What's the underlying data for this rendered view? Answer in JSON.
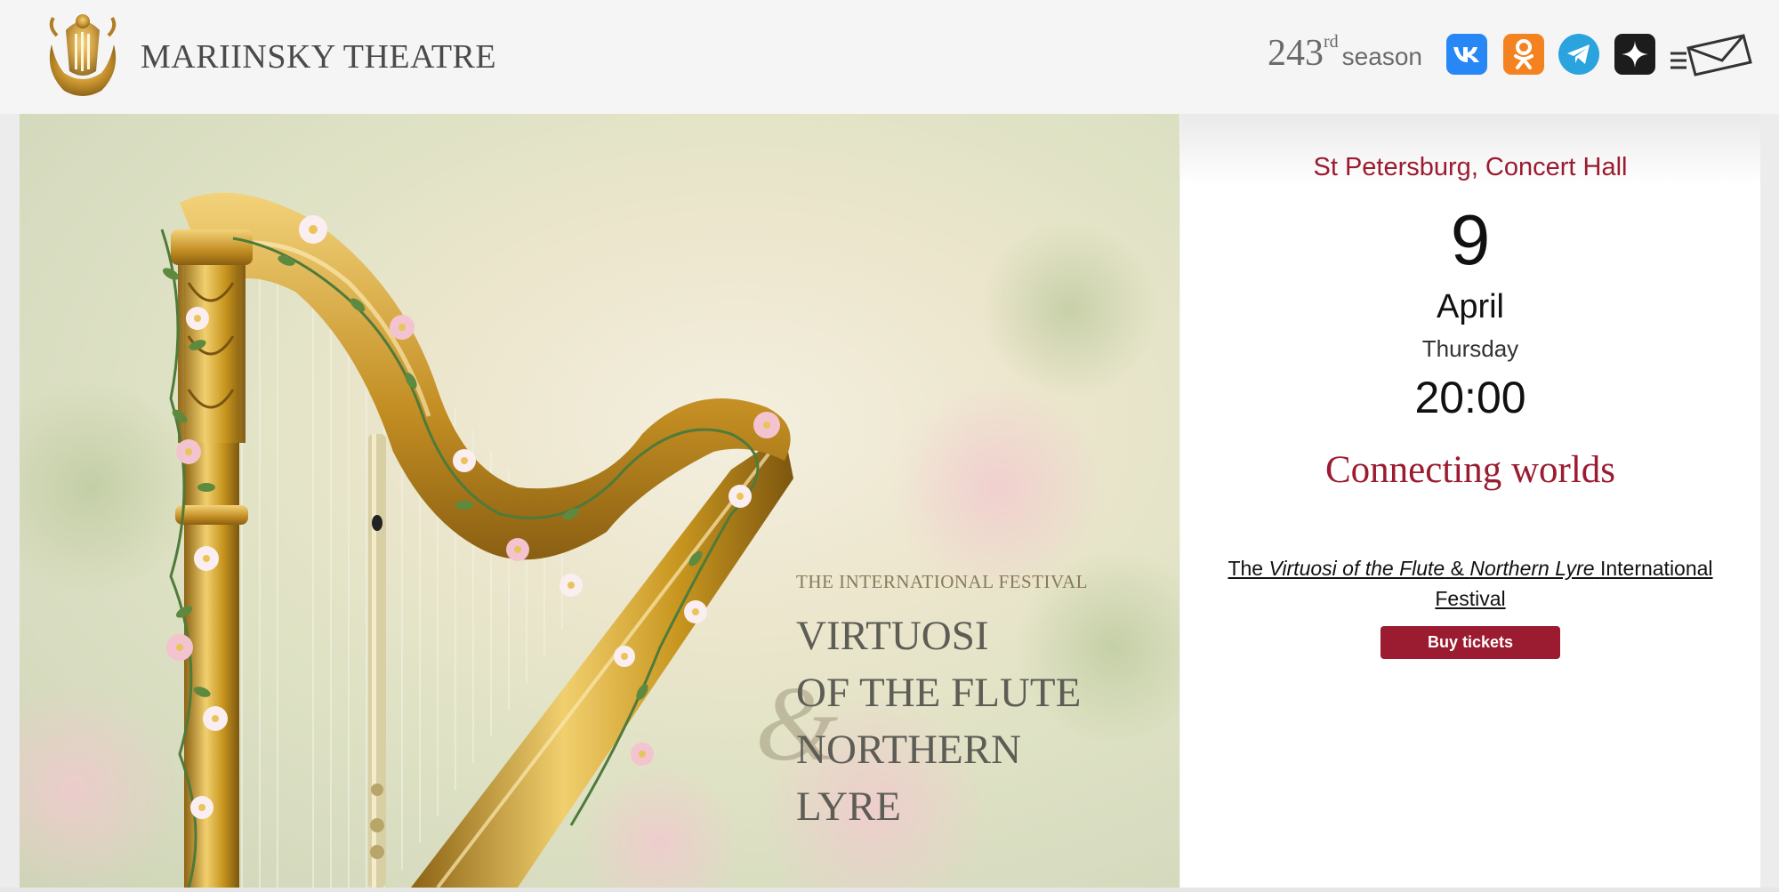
{
  "header": {
    "brand": "MARIINSKY THEATRE",
    "season_number": "243",
    "season_suffix": "rd",
    "season_word": "season",
    "social": [
      {
        "name": "vk-icon",
        "label": "VK",
        "color": "#2787f5"
      },
      {
        "name": "odnoklassniki-icon",
        "label": "OK",
        "color": "#f58220"
      },
      {
        "name": "telegram-icon",
        "label": "Telegram",
        "color": "#2aa3df"
      },
      {
        "name": "dzen-icon",
        "label": "Dzen",
        "color": "#1c1c1c"
      }
    ],
    "menu_icon": "menu-envelope-icon"
  },
  "hero": {
    "image": "harp-with-flowers-and-flute",
    "eyebrow": "THE INTERNATIONAL FESTIVAL",
    "lines": [
      "VIRTUOSI",
      "OF THE FLUTE",
      "NORTHERN",
      "LYRE"
    ],
    "ampersand": "&"
  },
  "event": {
    "venue": "St Petersburg, Concert Hall",
    "day": "9",
    "month": "April",
    "weekday": "Thursday",
    "time": "20:00",
    "title": "Connecting worlds",
    "desc_the": "The ",
    "desc_virtuosi": "Virtuosi of the Flute",
    "desc_amp": " & ",
    "desc_lyre": "Northern Lyre",
    "desc_rest": " International Festival",
    "buy_label": "Buy tickets"
  },
  "colors": {
    "accent": "#9b1b30",
    "header_bg": "#f5f5f5"
  }
}
